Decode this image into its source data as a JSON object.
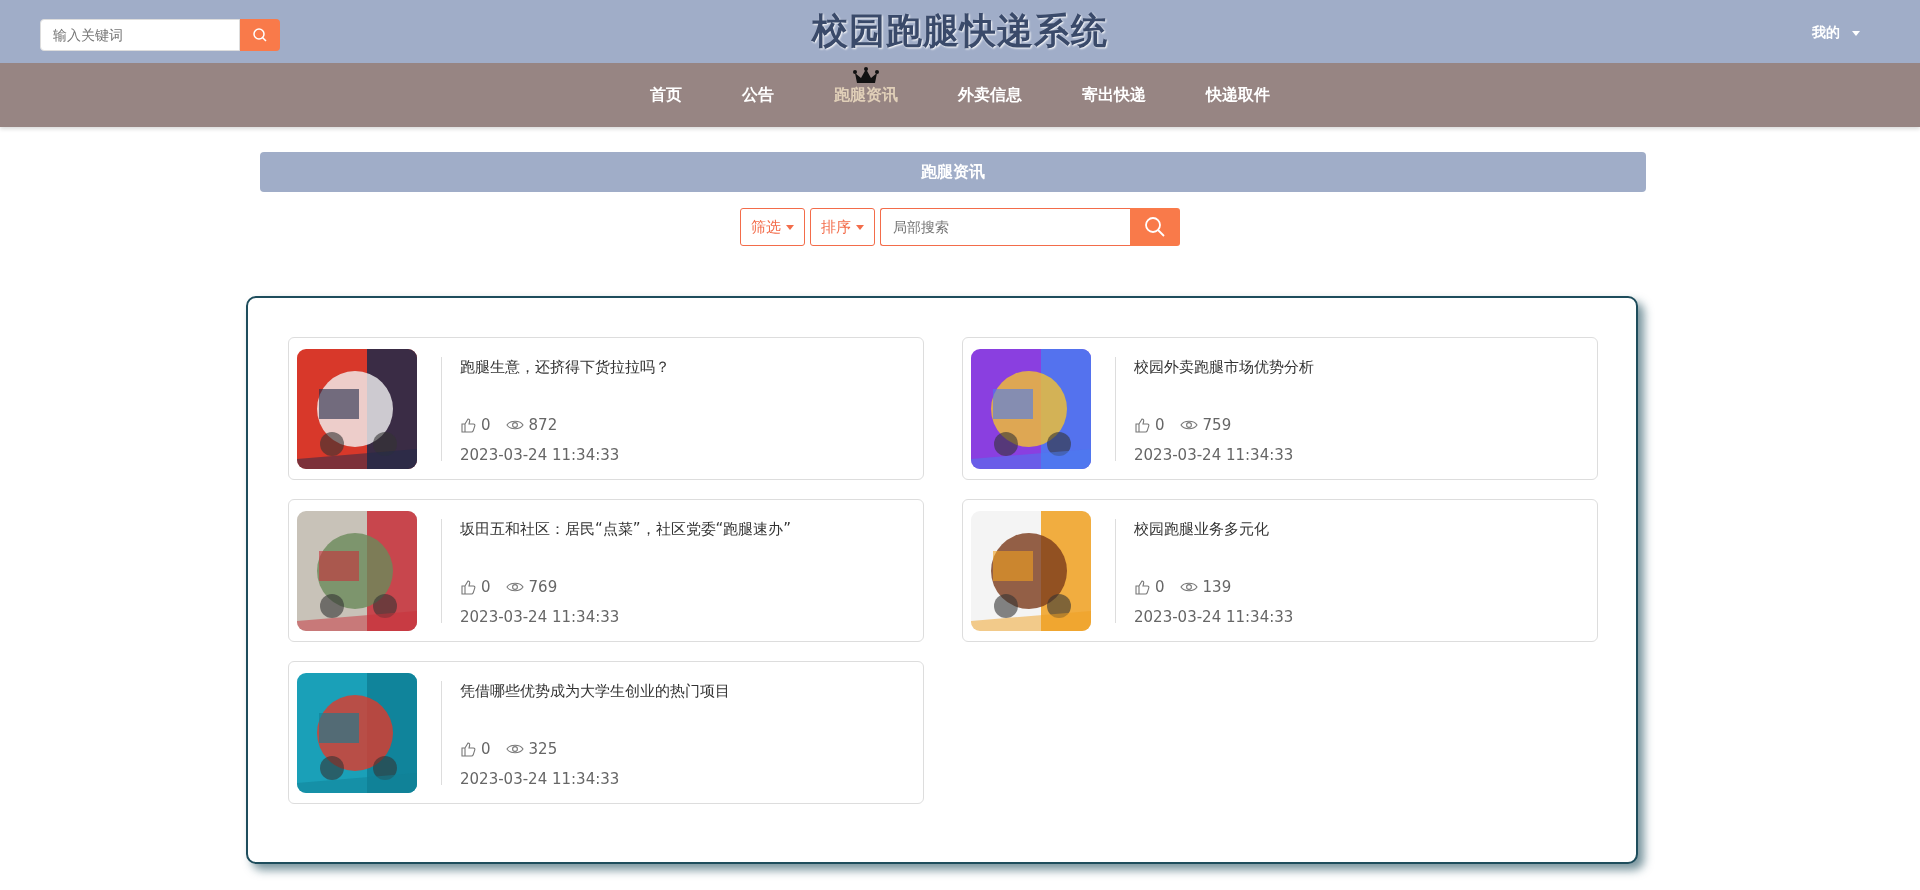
{
  "header": {
    "search": {
      "placeholder": "输入关键词"
    },
    "title": "校园跑腿快递系统",
    "user_menu": "我的"
  },
  "nav": [
    {
      "label": "首页",
      "selected": false
    },
    {
      "label": "公告",
      "selected": false
    },
    {
      "label": "跑腿资讯",
      "selected": true
    },
    {
      "label": "外卖信息",
      "selected": false
    },
    {
      "label": "寄出快递",
      "selected": false
    },
    {
      "label": "快递取件",
      "selected": false
    }
  ],
  "section_title": "跑腿资讯",
  "toolbar": {
    "filter": "筛选",
    "sort": "排序",
    "search": {
      "placeholder": "局部搜索"
    }
  },
  "articles": [
    {
      "title": "跑腿生意，还挤得下货拉拉吗？",
      "likes": "0",
      "views": "872",
      "date": "2023-03-24 11:34:33"
    },
    {
      "title": "校园外卖跑腿市场优势分析",
      "likes": "0",
      "views": "759",
      "date": "2023-03-24 11:34:33"
    },
    {
      "title": "坂田五和社区：居民“点菜”，社区党委“跑腿速办”",
      "likes": "0",
      "views": "769",
      "date": "2023-03-24 11:34:33"
    },
    {
      "title": "校园跑腿业务多元化",
      "likes": "0",
      "views": "139",
      "date": "2023-03-24 11:34:33"
    },
    {
      "title": "凭借哪些优势成为大学生创业的热门项目",
      "likes": "0",
      "views": "325",
      "date": "2023-03-24 11:34:33"
    }
  ]
}
